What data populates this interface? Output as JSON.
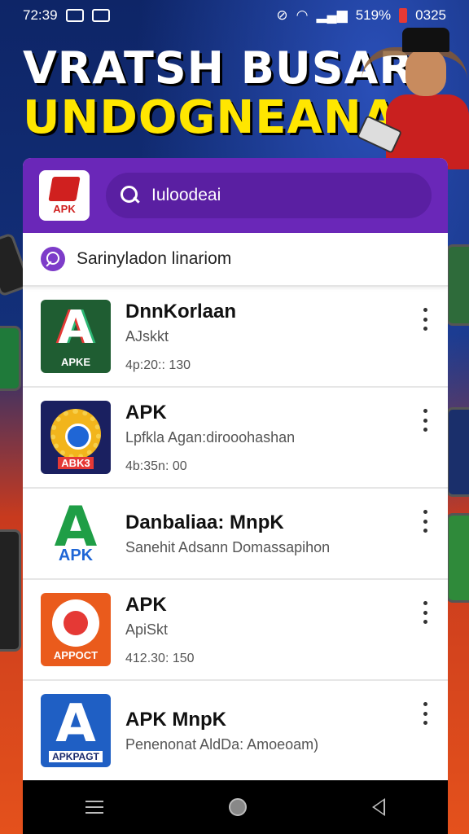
{
  "status_bar": {
    "time": "72:39",
    "battery_text": "519%",
    "clock_right": "0325"
  },
  "banner": {
    "line1": "VRATSH BUSAR",
    "line2": "UNDOGNEANA"
  },
  "header": {
    "logo_label": "APK",
    "search_text": "Iuloodeai"
  },
  "sub_header": {
    "label": "Sarinyladon linariom"
  },
  "apps": [
    {
      "name": "DnnKorlaan",
      "subtitle": "AJskkt",
      "meta": "4p:20:: 130",
      "icon_tag": "APKE",
      "glyph": "A"
    },
    {
      "name": "APK",
      "subtitle": "Lpfkla Agan:dirooohashan",
      "meta": "4b:35n: 00",
      "icon_tag": "ABK3",
      "glyph": ""
    },
    {
      "name": "Danbaliaa: MnpK",
      "subtitle": "Sanehit Adsann Domassapihon",
      "meta": "",
      "icon_tag": "APK",
      "glyph": "A"
    },
    {
      "name": "APK",
      "subtitle": "ApiSkt",
      "meta": "412.30: 150",
      "icon_tag": "APPOCT",
      "glyph": ""
    },
    {
      "name": "APK MnpK",
      "subtitle": "Penenonat AldDa: Amoeoam)",
      "meta": "",
      "icon_tag": "APKPAGT",
      "glyph": "A"
    }
  ],
  "colors": {
    "header_purple": "#6a27b8",
    "banner_yellow": "#ffe600"
  }
}
